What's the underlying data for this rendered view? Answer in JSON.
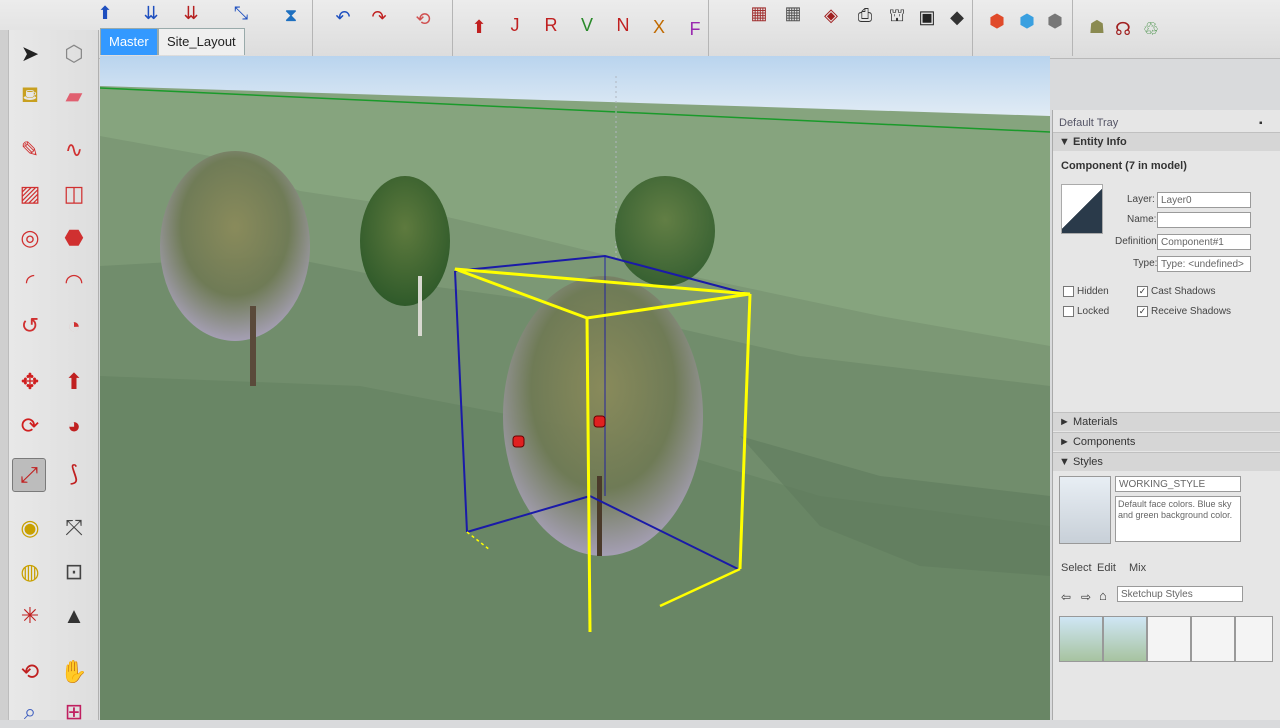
{
  "tabs": [
    {
      "label": "Master",
      "active": true
    },
    {
      "label": "Site_Layout",
      "active": false
    }
  ],
  "toolbar": {
    "groups": [
      "view-tools",
      "edit-tools",
      "axis-tools",
      "styles-tools",
      "view-modes",
      "extension-tools"
    ],
    "axis_icons": [
      "J",
      "R",
      "V",
      "N",
      "X",
      "F"
    ]
  },
  "tray": {
    "title": "Default Tray",
    "entity_info": {
      "title": "Entity Info",
      "component_label": "Component (7 in model)",
      "layer_label": "Layer:",
      "layer_value": "Layer0",
      "name_label": "Name:",
      "name_value": "",
      "definition_label": "Definition:",
      "definition_value": "Component#1",
      "type_label": "Type:",
      "type_value": "Type: <undefined>",
      "hidden_label": "Hidden",
      "locked_label": "Locked",
      "cast_shadows_label": "Cast Shadows",
      "receive_shadows_label": "Receive Shadows"
    },
    "materials_label": "Materials",
    "components_label": "Components",
    "styles": {
      "title": "Styles",
      "style_name": "WORKING_STYLE",
      "description": "Default face colors. Blue sky and green background color.",
      "tab_select": "Select",
      "tab_edit": "Edit",
      "tab_mix": "Mix",
      "collection": "Sketchup Styles"
    }
  },
  "colors": {
    "sky": "#dde9f5",
    "ground": "#7f9a7a",
    "selection_yellow": "#ffff00",
    "bbox_blue": "#1a1aa8",
    "tab_active": "#3399ff"
  }
}
